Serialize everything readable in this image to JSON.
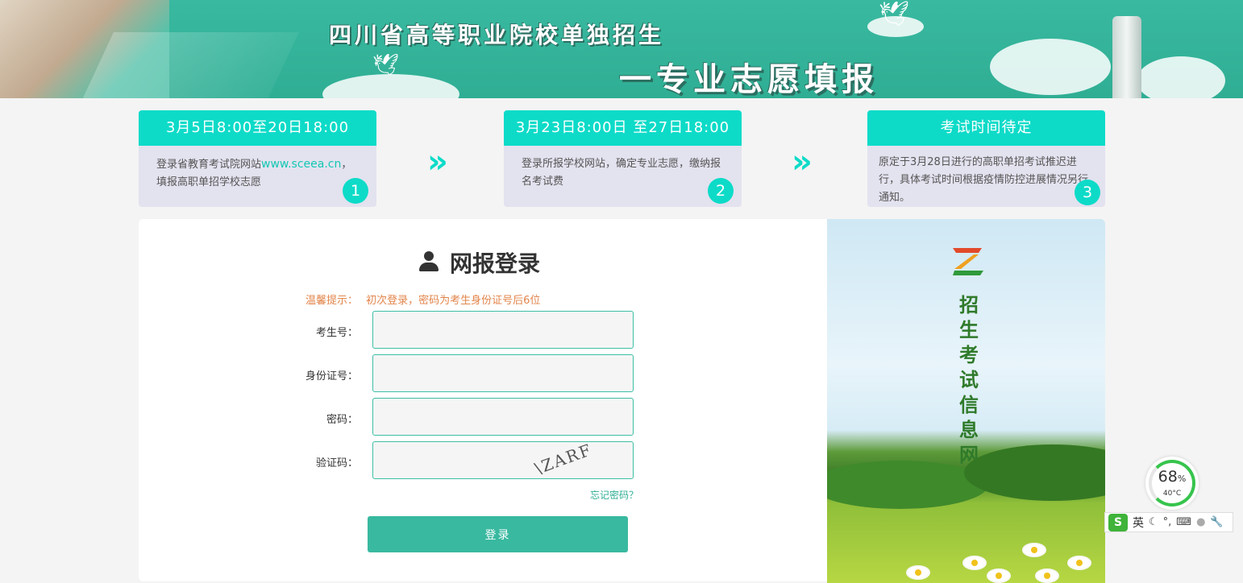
{
  "banner": {
    "title_line1": "四川省高等职业院校单独招生",
    "title_line2": "一专业志愿填报"
  },
  "steps": [
    {
      "time": "3月5日8:00至20日18:00",
      "text_before_link": "登录省教育考试院网站",
      "link": "www.sceea.cn",
      "text_after_link": "，填报高职单招学校志愿",
      "number": "1"
    },
    {
      "time": "3月23日8:00日 至27日18:00",
      "text": "登录所报学校网站，确定专业志愿，缴纳报名考试费",
      "number": "2"
    },
    {
      "time": "考试时间待定",
      "text": "原定于3月28日进行的高职单招考试推迟进行，具体考试时间根据疫情防控进展情况另行通知。",
      "number": "3"
    }
  ],
  "arrows": [
    "»",
    "»"
  ],
  "login": {
    "title": "网报登录",
    "tip_label": "温馨提示：",
    "tip_text": "初次登录，密码为考生身份证号后6位",
    "fields": [
      {
        "label": "考生号：",
        "value": ""
      },
      {
        "label": "身份证号：",
        "value": ""
      },
      {
        "label": "密码：",
        "value": ""
      },
      {
        "label": "验证码：",
        "value": ""
      }
    ],
    "captcha_text": "\\ZARF",
    "forgot": "忘记密码？",
    "submit": "登录"
  },
  "poster": {
    "vertical_title": "招生考试信息网"
  },
  "widgets": {
    "gauge_percent": "68",
    "gauge_percent_sign": "%",
    "gauge_temp": "40°C",
    "ime_label": "英"
  },
  "colors": {
    "banner": "#39b9a0",
    "step_header": "#0ddbc8",
    "step_body": "#e3e2ef",
    "tip": "#e2844a",
    "button": "#39b9a0",
    "poster_title": "#2f7a2a"
  }
}
